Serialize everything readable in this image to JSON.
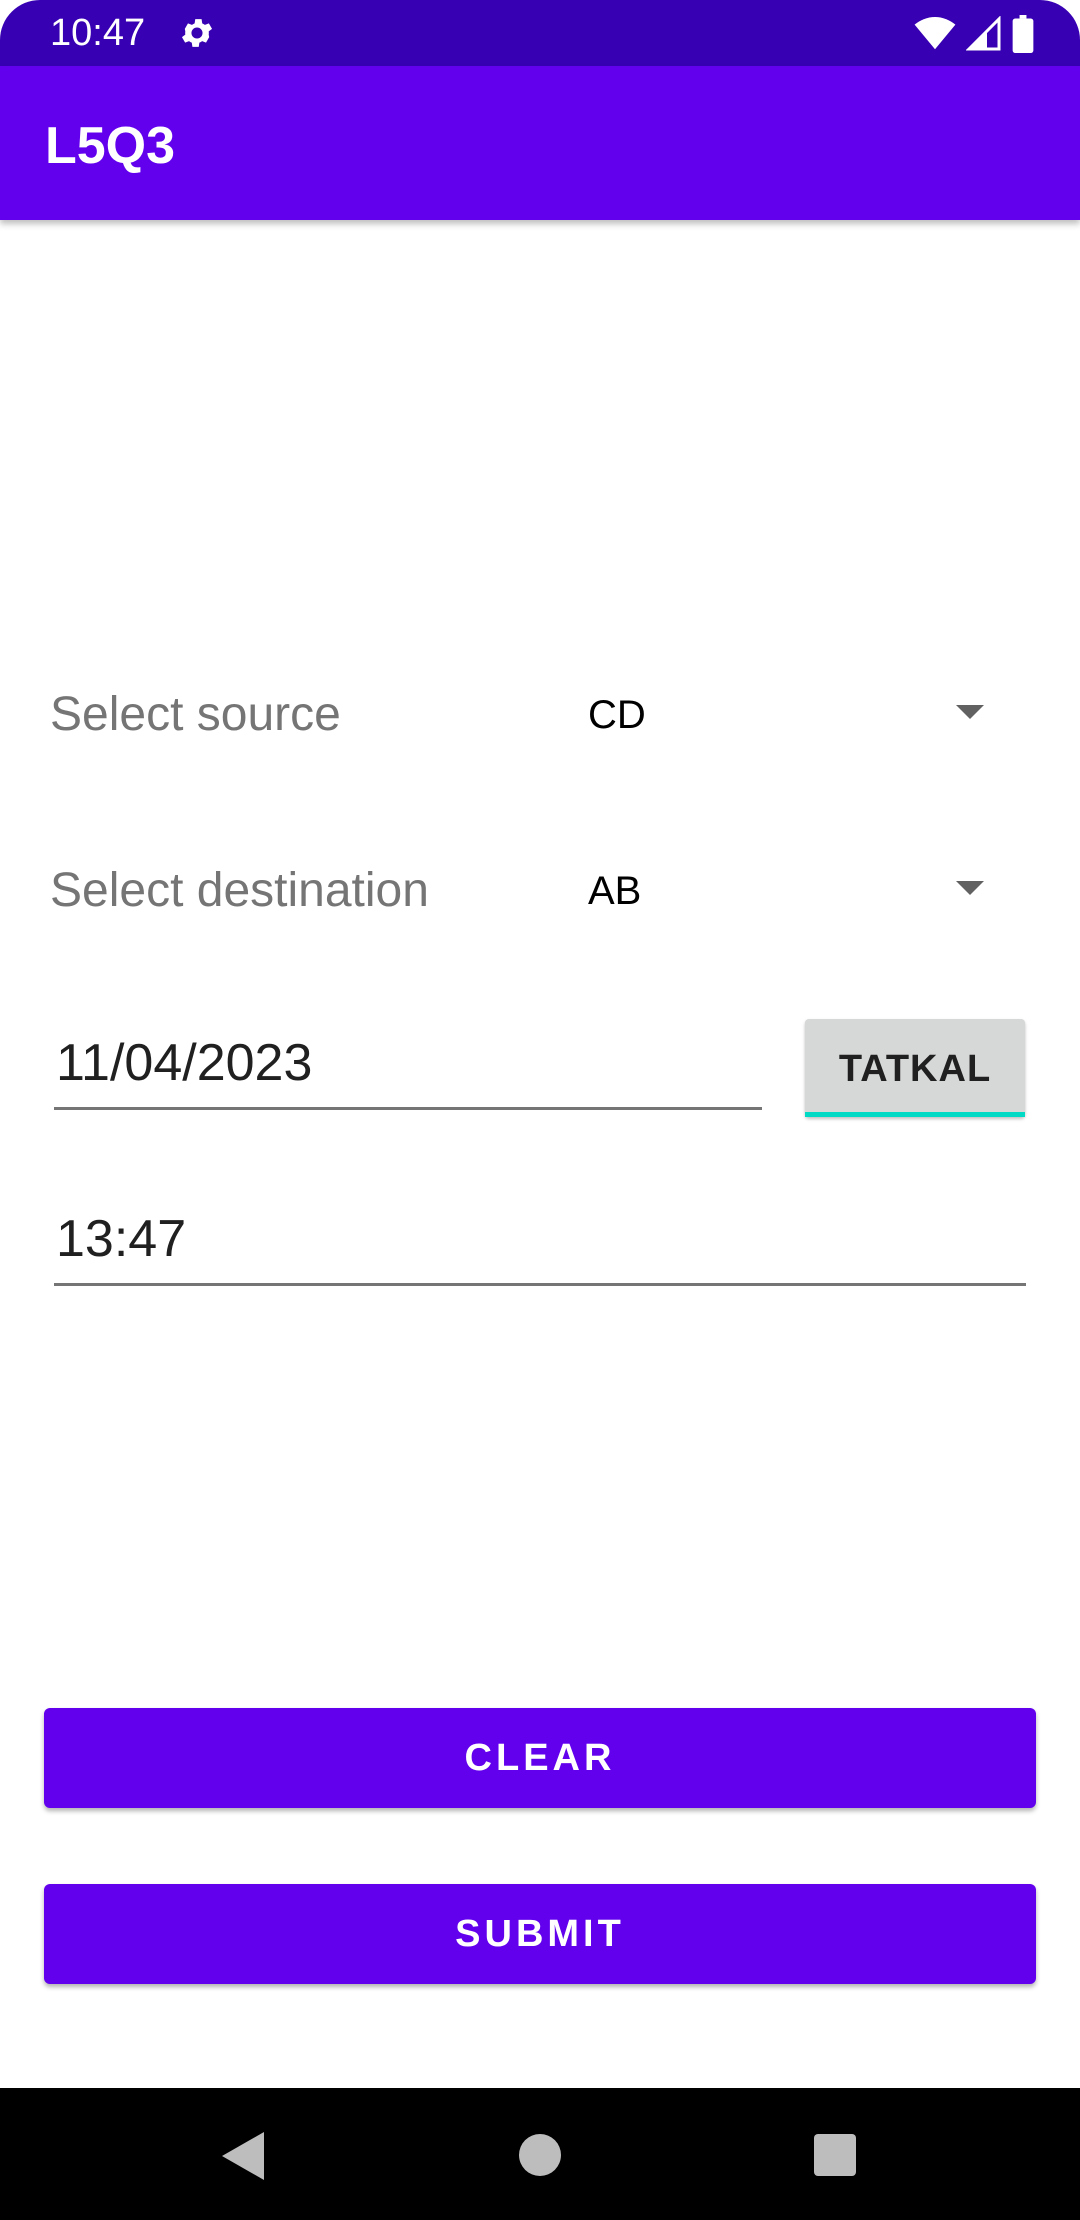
{
  "status_bar": {
    "time": "10:47",
    "icons": [
      "gear-icon",
      "wifi-icon",
      "signal-icon",
      "battery-icon"
    ]
  },
  "app_bar": {
    "title": "L5Q3"
  },
  "form": {
    "source": {
      "label": "Select source",
      "value": "CD"
    },
    "destination": {
      "label": "Select destination",
      "value": "AB"
    },
    "date": {
      "value": "11/04/2023"
    },
    "tatkal_button": {
      "label": "TATKAL"
    },
    "time": {
      "value": "13:47"
    }
  },
  "actions": {
    "clear_label": "CLEAR",
    "submit_label": "SUBMIT"
  },
  "nav_bar": {
    "icons": [
      "back-icon",
      "home-icon",
      "recents-icon"
    ]
  },
  "colors": {
    "status_bar": "#3700b3",
    "primary": "#6200ee",
    "accent": "#03dac5",
    "tatkal_bg": "#d6d7d7"
  }
}
